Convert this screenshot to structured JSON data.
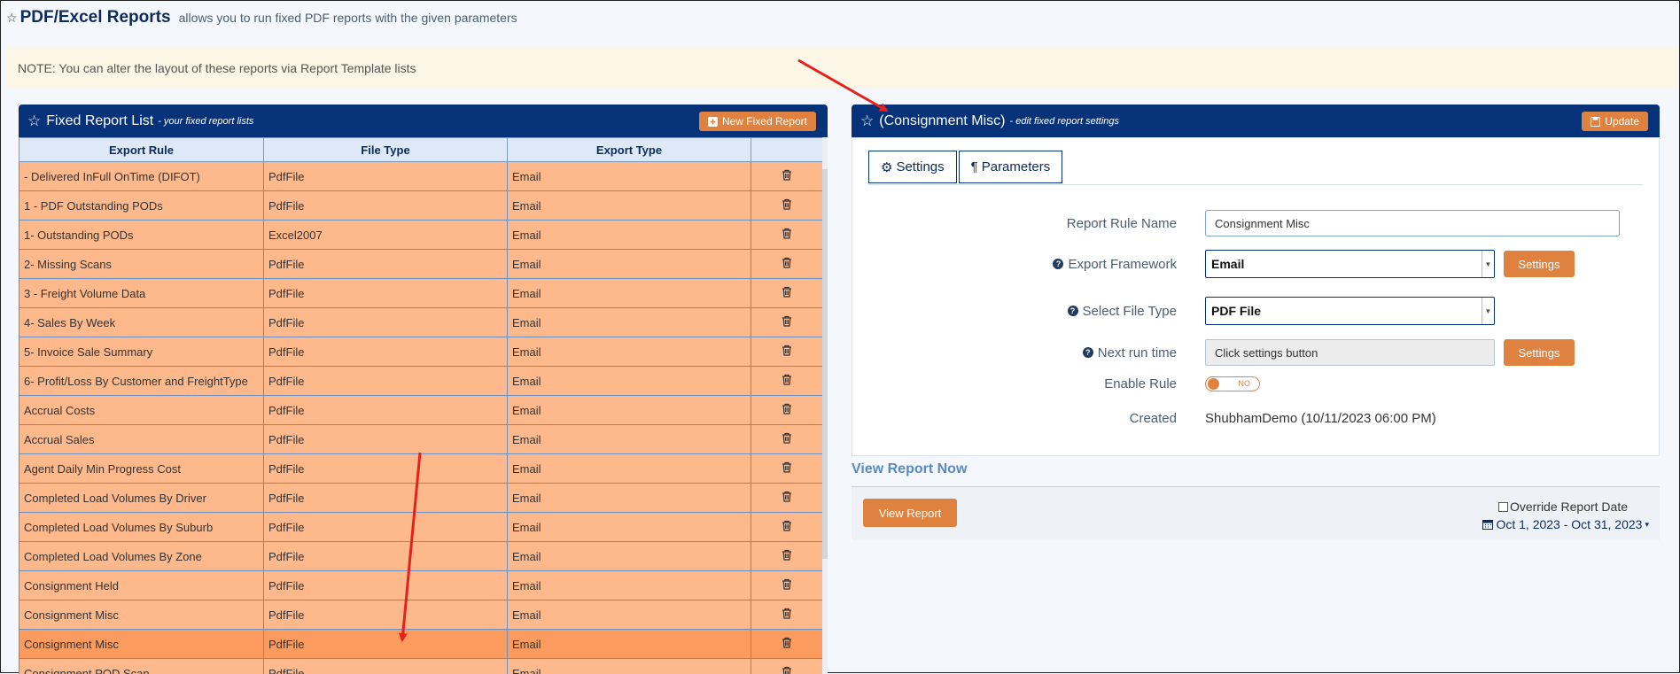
{
  "header": {
    "title": "PDF/Excel Reports",
    "subtitle": "allows you to run fixed PDF reports with the given parameters"
  },
  "note": "NOTE: You can alter the layout of these reports via Report Template lists",
  "fixed_list": {
    "title": "Fixed Report List",
    "subtitle": "- your fixed report lists",
    "new_button": "New Fixed Report",
    "columns": [
      "Export Rule",
      "File Type",
      "Export Type",
      ""
    ],
    "rows": [
      {
        "rule": "- Delivered InFull OnTime (DIFOT)",
        "file_type": "PdfFile",
        "export_type": "Email"
      },
      {
        "rule": "1 - PDF Outstanding PODs",
        "file_type": "PdfFile",
        "export_type": "Email"
      },
      {
        "rule": "1- Outstanding PODs",
        "file_type": "Excel2007",
        "export_type": "Email"
      },
      {
        "rule": "2- Missing Scans",
        "file_type": "PdfFile",
        "export_type": "Email"
      },
      {
        "rule": "3 - Freight Volume Data",
        "file_type": "PdfFile",
        "export_type": "Email"
      },
      {
        "rule": "4- Sales By Week",
        "file_type": "PdfFile",
        "export_type": "Email"
      },
      {
        "rule": "5- Invoice Sale Summary",
        "file_type": "PdfFile",
        "export_type": "Email"
      },
      {
        "rule": "6- Profit/Loss By Customer and FreightType",
        "file_type": "PdfFile",
        "export_type": "Email"
      },
      {
        "rule": "Accrual Costs",
        "file_type": "PdfFile",
        "export_type": "Email"
      },
      {
        "rule": "Accrual Sales",
        "file_type": "PdfFile",
        "export_type": "Email"
      },
      {
        "rule": "Agent Daily Min Progress Cost",
        "file_type": "PdfFile",
        "export_type": "Email"
      },
      {
        "rule": "Completed Load Volumes By Driver",
        "file_type": "PdfFile",
        "export_type": "Email"
      },
      {
        "rule": "Completed Load Volumes By Suburb",
        "file_type": "PdfFile",
        "export_type": "Email"
      },
      {
        "rule": "Completed Load Volumes By Zone",
        "file_type": "PdfFile",
        "export_type": "Email"
      },
      {
        "rule": "Consignment Held",
        "file_type": "PdfFile",
        "export_type": "Email"
      },
      {
        "rule": "Consignment Misc",
        "file_type": "PdfFile",
        "export_type": "Email"
      },
      {
        "rule": "Consignment Misc",
        "file_type": "PdfFile",
        "export_type": "Email",
        "selected": true
      },
      {
        "rule": "Consignment POD Scan",
        "file_type": "PdfFile",
        "export_type": "Email"
      }
    ]
  },
  "detail": {
    "title": "(Consignment Misc)",
    "subtitle": "- edit fixed report settings",
    "update_button": "Update",
    "tabs": [
      "Settings",
      "Parameters"
    ],
    "fields": {
      "rule_name_label": "Report Rule Name",
      "rule_name_value": "Consignment Misc",
      "framework_label": "Export Framework",
      "framework_value": "Email",
      "file_type_label": "Select File Type",
      "file_type_value": "PDF File",
      "next_run_label": "Next run time",
      "next_run_value": "Click settings button",
      "enable_label": "Enable Rule",
      "enable_toggle": "NO",
      "created_label": "Created",
      "created_value": "ShubhamDemo (10/11/2023 06:00 PM)",
      "settings_button": "Settings"
    }
  },
  "view": {
    "title": "View Report Now",
    "button": "View Report",
    "override_label": "Override Report Date",
    "date_range": "Oct 1, 2023 - Oct 31, 2023"
  },
  "colors": {
    "panel_header": "#06327a",
    "row": "#fdb98c",
    "row_selected": "#fb9b5e",
    "accent": "#e0823f",
    "annotation_arrow": "#e8201c"
  }
}
